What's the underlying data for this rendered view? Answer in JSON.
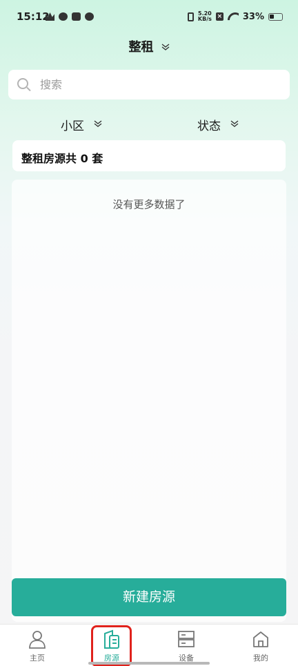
{
  "status_bar": {
    "time": "15:12",
    "network_speed_value": "5.20",
    "network_speed_unit": "KB/s",
    "battery": "33%"
  },
  "header": {
    "title": "整租"
  },
  "search": {
    "placeholder": "搜索",
    "value": ""
  },
  "filters": {
    "community_label": "小区",
    "status_label": "状态"
  },
  "summary": {
    "text": "整租房源共 0 套"
  },
  "list": {
    "empty_text": "没有更多数据了"
  },
  "actions": {
    "add_label": "新建房源"
  },
  "tab_bar": {
    "items": [
      {
        "label": "主页",
        "icon": "user-icon"
      },
      {
        "label": "房源",
        "icon": "house-doc-icon",
        "active": true
      },
      {
        "label": "设备",
        "icon": "device-icon"
      },
      {
        "label": "我的",
        "icon": "home-icon"
      }
    ]
  },
  "colors": {
    "accent": "#27ad9a",
    "highlight": "#e0221c",
    "background_top": "#cdf4e2"
  }
}
